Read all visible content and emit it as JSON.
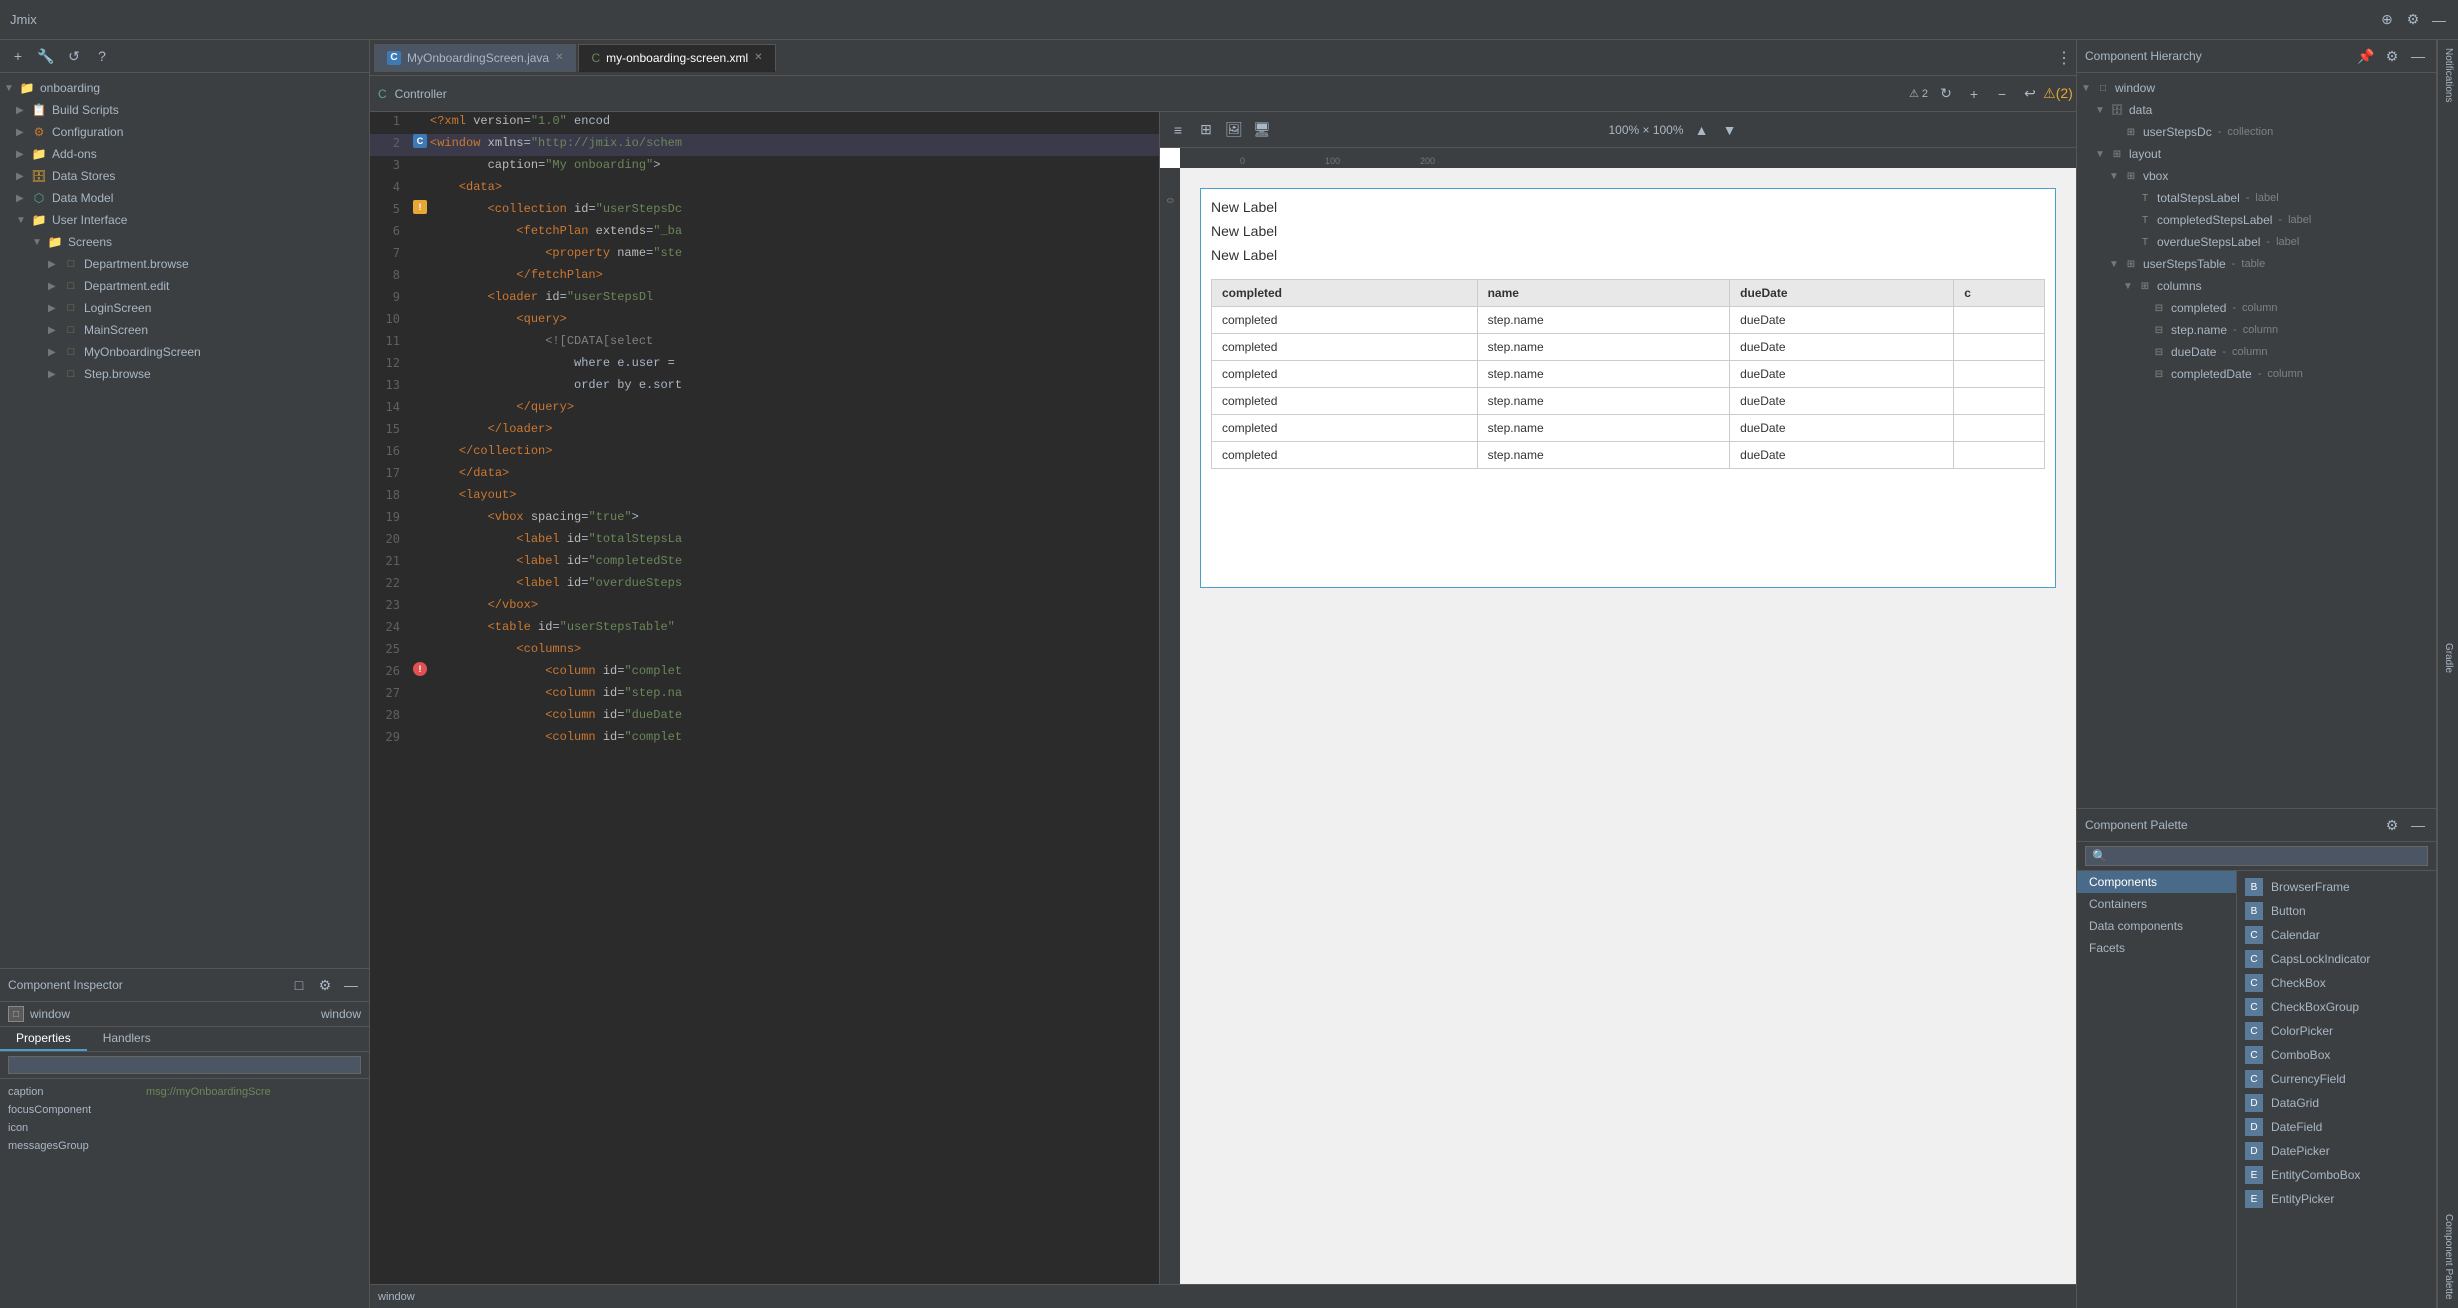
{
  "app": {
    "title": "Jmix",
    "title_icon": "jmix-icon"
  },
  "tabs": [
    {
      "id": "java-tab",
      "label": "MyOnboardingScreen.java",
      "icon": "java-icon",
      "active": false,
      "closeable": true
    },
    {
      "id": "xml-tab",
      "label": "my-onboarding-screen.xml",
      "icon": "xml-icon",
      "active": true,
      "closeable": true
    }
  ],
  "editor": {
    "toolbar_label": "Controller",
    "lines": [
      {
        "num": 1,
        "content": "<?xml version=\"1.0\" encod",
        "gutter": ""
      },
      {
        "num": 2,
        "content": "<window xmlns=\"http://jmix.io/schem",
        "gutter": "c",
        "highlight": true
      },
      {
        "num": 3,
        "content": "        caption=\"My onboarding\">",
        "gutter": ""
      },
      {
        "num": 4,
        "content": "    <data>",
        "gutter": ""
      },
      {
        "num": 5,
        "content": "        <collection id=\"userStepsDc",
        "gutter": "warn"
      },
      {
        "num": 6,
        "content": "            <fetchPlan extends=\"_ba",
        "gutter": ""
      },
      {
        "num": 7,
        "content": "                <property name=\"ste",
        "gutter": ""
      },
      {
        "num": 8,
        "content": "            </fetchPlan>",
        "gutter": ""
      },
      {
        "num": 9,
        "content": "        <loader id=\"userStepsDl",
        "gutter": ""
      },
      {
        "num": 10,
        "content": "            <query>",
        "gutter": ""
      },
      {
        "num": 11,
        "content": "                <![CDATA[select",
        "gutter": ""
      },
      {
        "num": 12,
        "content": "                    where e.user =",
        "gutter": ""
      },
      {
        "num": 13,
        "content": "                    order by e.sort",
        "gutter": ""
      },
      {
        "num": 14,
        "content": "            </query>",
        "gutter": ""
      },
      {
        "num": 15,
        "content": "        </loader>",
        "gutter": ""
      },
      {
        "num": 16,
        "content": "    </collection>",
        "gutter": ""
      },
      {
        "num": 17,
        "content": "    </data>",
        "gutter": ""
      },
      {
        "num": 18,
        "content": "    <layout>",
        "gutter": ""
      },
      {
        "num": 19,
        "content": "        <vbox spacing=\"true\">",
        "gutter": ""
      },
      {
        "num": 20,
        "content": "            <label id=\"totalStepsLa",
        "gutter": ""
      },
      {
        "num": 21,
        "content": "            <label id=\"completedSte",
        "gutter": ""
      },
      {
        "num": 22,
        "content": "            <label id=\"overdueSteps",
        "gutter": ""
      },
      {
        "num": 23,
        "content": "        </vbox>",
        "gutter": ""
      },
      {
        "num": 24,
        "content": "        <table id=\"userStepsTable\"",
        "gutter": ""
      },
      {
        "num": 25,
        "content": "            <columns>",
        "gutter": ""
      },
      {
        "num": 26,
        "content": "                <column id=\"complet",
        "gutter": "error"
      },
      {
        "num": 27,
        "content": "                <column id=\"step.na",
        "gutter": ""
      },
      {
        "num": 28,
        "content": "                <column id=\"dueDate",
        "gutter": ""
      },
      {
        "num": 29,
        "content": "                <column id=\"complet",
        "gutter": ""
      }
    ]
  },
  "preview": {
    "zoom": "100% × 100%",
    "labels": [
      "New Label",
      "New Label",
      "New Label"
    ],
    "table": {
      "headers": [
        "completed",
        "name",
        "dueDate",
        "c"
      ],
      "rows": [
        [
          "completed",
          "step.name",
          "dueDate",
          ""
        ],
        [
          "completed",
          "step.name",
          "dueDate",
          ""
        ],
        [
          "completed",
          "step.name",
          "dueDate",
          ""
        ],
        [
          "completed",
          "step.name",
          "dueDate",
          ""
        ],
        [
          "completed",
          "step.name",
          "dueDate",
          ""
        ],
        [
          "completed",
          "step.name",
          "dueDate",
          ""
        ]
      ]
    }
  },
  "project_tree": {
    "root": "onboarding",
    "items": [
      {
        "id": "build-scripts",
        "label": "Build Scripts",
        "level": 1,
        "type": "folder",
        "expanded": false
      },
      {
        "id": "configuration",
        "label": "Configuration",
        "level": 1,
        "type": "folder",
        "expanded": false
      },
      {
        "id": "add-ons",
        "label": "Add-ons",
        "level": 1,
        "type": "folder",
        "expanded": false
      },
      {
        "id": "data-stores",
        "label": "Data Stores",
        "level": 1,
        "type": "folder",
        "expanded": false
      },
      {
        "id": "data-model",
        "label": "Data Model",
        "level": 1,
        "type": "folder",
        "expanded": false
      },
      {
        "id": "user-interface",
        "label": "User Interface",
        "level": 1,
        "type": "folder",
        "expanded": true
      },
      {
        "id": "screens",
        "label": "Screens",
        "level": 2,
        "type": "folder",
        "expanded": true
      },
      {
        "id": "dept-browse",
        "label": "Department.browse",
        "level": 3,
        "type": "screen",
        "expanded": false
      },
      {
        "id": "dept-edit",
        "label": "Department.edit",
        "level": 3,
        "type": "screen",
        "expanded": false
      },
      {
        "id": "login-screen",
        "label": "LoginScreen",
        "level": 3,
        "type": "screen",
        "expanded": false
      },
      {
        "id": "main-screen",
        "label": "MainScreen",
        "level": 3,
        "type": "screen",
        "expanded": false
      },
      {
        "id": "my-onboarding",
        "label": "MyOnboardingScreen",
        "level": 3,
        "type": "screen",
        "expanded": false
      },
      {
        "id": "step-browse",
        "label": "Step.browse",
        "level": 3,
        "type": "screen",
        "expanded": false
      }
    ]
  },
  "inspector": {
    "title": "Component Inspector",
    "window_label": "window",
    "window_type": "window",
    "tabs": [
      "Properties",
      "Handlers"
    ],
    "active_tab": "Properties",
    "search_placeholder": "",
    "properties": [
      {
        "key": "caption",
        "value": "msg://myOnboardingScre"
      },
      {
        "key": "focusComponent",
        "value": ""
      },
      {
        "key": "icon",
        "value": ""
      },
      {
        "key": "messagesGroup",
        "value": ""
      }
    ]
  },
  "hierarchy": {
    "title": "Component Hierarchy",
    "items": [
      {
        "id": "h-window",
        "label": "window",
        "type": "",
        "level": 0,
        "expanded": true
      },
      {
        "id": "h-data",
        "label": "data",
        "type": "",
        "level": 1,
        "expanded": true
      },
      {
        "id": "h-userStepsDc",
        "label": "userStepsDc",
        "type": "collection",
        "level": 2,
        "expanded": false
      },
      {
        "id": "h-layout",
        "label": "layout",
        "type": "",
        "level": 1,
        "expanded": true
      },
      {
        "id": "h-vbox",
        "label": "vbox",
        "type": "",
        "level": 2,
        "expanded": true
      },
      {
        "id": "h-totalStepsLabel",
        "label": "totalStepsLabel",
        "type": "label",
        "level": 3,
        "expanded": false
      },
      {
        "id": "h-completedStepsLabel",
        "label": "completedStepsLabel",
        "type": "label",
        "level": 3,
        "expanded": false
      },
      {
        "id": "h-overdueStepsLabel",
        "label": "overdueStepsLabel",
        "type": "label",
        "level": 3,
        "expanded": false
      },
      {
        "id": "h-userStepsTable",
        "label": "userStepsTable",
        "type": "table",
        "level": 2,
        "expanded": true
      },
      {
        "id": "h-columns",
        "label": "columns",
        "type": "",
        "level": 3,
        "expanded": true
      },
      {
        "id": "h-completed-col",
        "label": "completed",
        "type": "column",
        "level": 4,
        "expanded": false
      },
      {
        "id": "h-step-name-col",
        "label": "step.name",
        "type": "column",
        "level": 4,
        "expanded": false
      },
      {
        "id": "h-dueDate-col",
        "label": "dueDate",
        "type": "column",
        "level": 4,
        "expanded": false
      },
      {
        "id": "h-completedDate-col",
        "label": "completedDate",
        "type": "column",
        "level": 4,
        "expanded": false
      }
    ]
  },
  "palette": {
    "title": "Component Palette",
    "search_placeholder": "",
    "categories": [
      "Components",
      "Containers",
      "Data components",
      "Facets"
    ],
    "active_category": "Components",
    "items": [
      {
        "id": "browser-frame",
        "label": "BrowserFrame"
      },
      {
        "id": "button",
        "label": "Button"
      },
      {
        "id": "calendar",
        "label": "Calendar"
      },
      {
        "id": "caps-lock-indicator",
        "label": "CapsLockIndicator"
      },
      {
        "id": "check-box",
        "label": "CheckBox"
      },
      {
        "id": "check-box-group",
        "label": "CheckBoxGroup"
      },
      {
        "id": "color-picker",
        "label": "ColorPicker"
      },
      {
        "id": "combo-box",
        "label": "ComboBox"
      },
      {
        "id": "currency-field",
        "label": "CurrencyField"
      },
      {
        "id": "data-grid",
        "label": "DataGrid"
      },
      {
        "id": "date-field",
        "label": "DateField"
      },
      {
        "id": "date-picker",
        "label": "DatePicker"
      },
      {
        "id": "entity-combo-box",
        "label": "EntityComboBox"
      },
      {
        "id": "entity-picker",
        "label": "EntityPicker"
      }
    ]
  },
  "side_labels": {
    "notifications": "Notifications",
    "gradle": "Gradle",
    "component_palette": "Component Palette"
  },
  "status_bar": {
    "window_label": "window"
  }
}
